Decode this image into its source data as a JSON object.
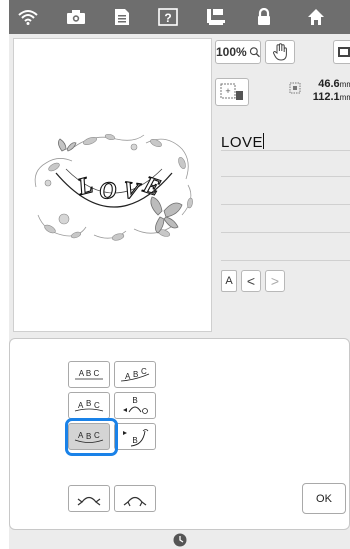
{
  "toolbar": {
    "icons": [
      "wifi-icon",
      "camera-icon",
      "document-icon",
      "help-icon",
      "sewing-machine-icon",
      "lock-icon",
      "home-icon"
    ]
  },
  "preview": {
    "embroidery_text": "LOVE"
  },
  "right_panel": {
    "zoom_label": "100%",
    "width_value": "46.6",
    "height_value": "112.1",
    "unit": "mm",
    "text_value": "LOVE",
    "char_type_label": "A",
    "prev_label": "<",
    "next_label": ">"
  },
  "arc_panel": {
    "buttons": [
      {
        "name": "arc-straight-button",
        "label": "A B C"
      },
      {
        "name": "arc-stairs-up-button",
        "label": "A B C"
      },
      {
        "name": "arc-curve-button",
        "label": "A B C"
      },
      {
        "name": "arc-vertical-rotate-button",
        "label": "B"
      },
      {
        "name": "arc-convex-button",
        "label": "A B C"
      },
      {
        "name": "arc-diagonal-button",
        "label": "B"
      }
    ],
    "ok_label": "OK"
  },
  "colors": {
    "accent": "#1a82e8",
    "toolbar": "#6e6e6e"
  }
}
